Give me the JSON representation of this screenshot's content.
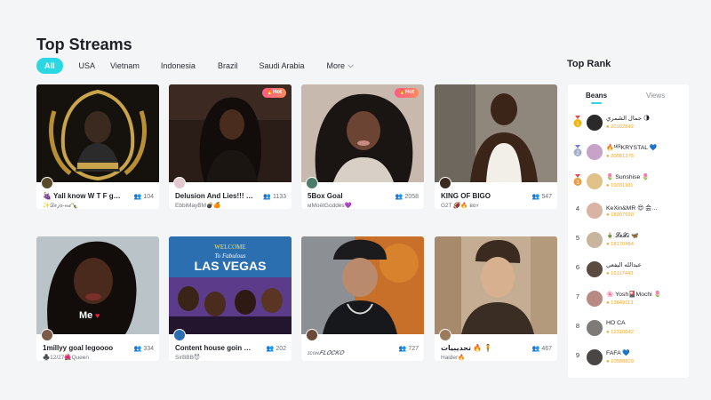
{
  "page": {
    "title": "Top Streams"
  },
  "tabs": [
    {
      "label": "All",
      "active": true
    },
    {
      "label": "USA"
    },
    {
      "label": "Vietnam"
    },
    {
      "label": "Indonesia"
    },
    {
      "label": "Brazil"
    },
    {
      "label": "Saudi Arabia"
    },
    {
      "label": "More"
    }
  ],
  "streams": [
    {
      "title": "🍇 Yall know W T F g…",
      "host": "✨𝒟𝑒𝒿𝑜-𝓃𝒹🍾",
      "viewers": "104",
      "hot": ""
    },
    {
      "title": "Delusion And Lies!!! …",
      "host": "EbbiMayBM💣🍊",
      "viewers": "1133",
      "hot": "Hot"
    },
    {
      "title": "5Box Goal",
      "host": "ᴍMoētGoddes💜",
      "viewers": "2058",
      "hot": "Hot"
    },
    {
      "title": "KING OF BIGO",
      "host": "G2T 🏈🔥 ʙᴏʏ",
      "viewers": "547",
      "hot": ""
    },
    {
      "title": "1millyy goal legoooo",
      "host": "♣️12/27🌺Queen",
      "viewers": "334",
      "hot": ""
    },
    {
      "title": "Content house goin …",
      "host": "SirBBB😈",
      "viewers": "202",
      "hot": ""
    },
    {
      "title": "",
      "host": "ɪᴄᴏɴ𝑭𝑳𝑶𝑪𝑲𝑶",
      "viewers": "727",
      "hot": ""
    },
    {
      "title": "تحديبيات 🔥 🧍",
      "host": "Haider🔥",
      "viewers": "467",
      "hot": ""
    }
  ],
  "rank": {
    "title": "Top Rank",
    "tabs": {
      "beans": "Beans",
      "views": "Views"
    },
    "rows": [
      {
        "num": "1",
        "name": "جمال الشمري 🌗",
        "beans": "20102842"
      },
      {
        "num": "2",
        "name": "🔥¹ᴷᴿKRYSTAL 💙",
        "beans": "20081375"
      },
      {
        "num": "3",
        "name": "🌷 Sunshise 🌷",
        "beans": "19031101"
      },
      {
        "num": "4",
        "name": "KeXin&MR 😍 会…",
        "beans": "18907690"
      },
      {
        "num": "5",
        "name": "🎍 𝓛𝓮𝓧𝓲 🦋",
        "beans": "18170454"
      },
      {
        "num": "6",
        "name": "عبدالله اليفعي",
        "beans": "16117443"
      },
      {
        "num": "7",
        "name": "🌸 Yosh🎴Mochi 🌷",
        "beans": "13849113"
      },
      {
        "num": "8",
        "name": "HỒ CA",
        "beans": "12310642"
      },
      {
        "num": "9",
        "name": "FAFA 💙",
        "beans": "10588829"
      }
    ]
  },
  "colors": {
    "accent": "#2ad7e2",
    "hot": "#ff5a8a",
    "beans": "#f5a623",
    "medal_gold": "#f5b20a",
    "medal_silver": "#a6aec9",
    "medal_bronze": "#f09a3c"
  }
}
